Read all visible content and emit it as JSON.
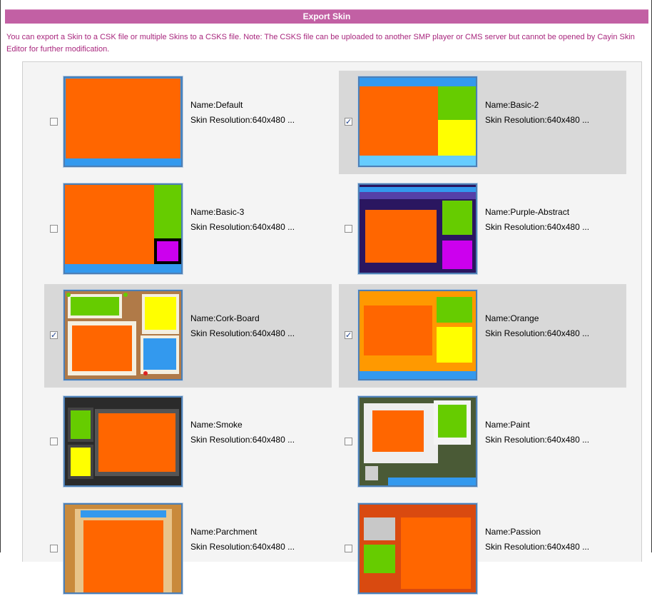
{
  "dialog": {
    "title": "Export Skin",
    "note": "You can export a Skin to a CSK file or multiple Skins to a CSKS file. Note: The CSKS file can be uploaded to another SMP player or CMS server but cannot be opened by Cayin Skin Editor for further modification."
  },
  "colors": {
    "accent": "#c260a4",
    "note_text": "#a8267d",
    "selected_bg": "#d8d8d8",
    "thumb_border": "#4d7fb5"
  },
  "skins": [
    {
      "name": "Name:Default",
      "resolution": "Skin Resolution:640x480 ...",
      "checked": false
    },
    {
      "name": "Name:Basic-2",
      "resolution": "Skin Resolution:640x480 ...",
      "checked": true
    },
    {
      "name": "Name:Basic-3",
      "resolution": "Skin Resolution:640x480 ...",
      "checked": false
    },
    {
      "name": "Name:Purple-Abstract",
      "resolution": "Skin Resolution:640x480 ...",
      "checked": false
    },
    {
      "name": "Name:Cork-Board",
      "resolution": "Skin Resolution:640x480 ...",
      "checked": true
    },
    {
      "name": "Name:Orange",
      "resolution": "Skin Resolution:640x480 ...",
      "checked": true
    },
    {
      "name": "Name:Smoke",
      "resolution": "Skin Resolution:640x480 ...",
      "checked": false
    },
    {
      "name": "Name:Paint",
      "resolution": "Skin Resolution:640x480 ...",
      "checked": false
    },
    {
      "name": "Name:Parchment",
      "resolution": "Skin Resolution:640x480 ...",
      "checked": false
    },
    {
      "name": "Name:Passion",
      "resolution": "Skin Resolution:640x480 ...",
      "checked": false
    }
  ]
}
